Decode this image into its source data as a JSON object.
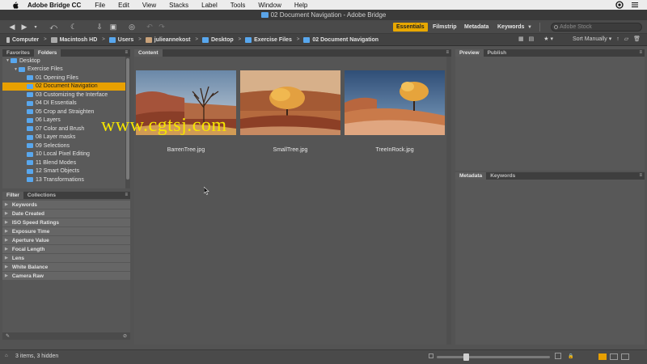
{
  "menubar": {
    "app_name": "Adobe Bridge CC",
    "items": [
      "File",
      "Edit",
      "View",
      "Stacks",
      "Label",
      "Tools",
      "Window",
      "Help"
    ]
  },
  "window": {
    "title": "02 Document Navigation - Adobe Bridge"
  },
  "workspaces": [
    {
      "label": "Essentials",
      "active": true
    },
    {
      "label": "Filmstrip",
      "active": false
    },
    {
      "label": "Metadata",
      "active": false
    },
    {
      "label": "Keywords",
      "active": false
    }
  ],
  "search": {
    "placeholder": "Adobe Stock"
  },
  "path": [
    {
      "label": "Computer"
    },
    {
      "label": "Macintosh HD"
    },
    {
      "label": "Users"
    },
    {
      "label": "julieannekost"
    },
    {
      "label": "Desktop"
    },
    {
      "label": "Exercise Files"
    },
    {
      "label": "02 Document Navigation"
    }
  ],
  "sort": {
    "label": "Sort Manually"
  },
  "left_top_tabs": [
    {
      "label": "Favorites",
      "active": false
    },
    {
      "label": "Folders",
      "active": true
    }
  ],
  "folders": [
    {
      "label": "Desktop",
      "level": 0,
      "selected": false
    },
    {
      "label": "Exercise Files",
      "level": 1,
      "selected": false
    },
    {
      "label": "01 Opening Files",
      "level": 2,
      "selected": false
    },
    {
      "label": "02 Document Navigation",
      "level": 2,
      "selected": true
    },
    {
      "label": "03 Customizing the Interface",
      "level": 2,
      "selected": false
    },
    {
      "label": "04 DI Essentials",
      "level": 2,
      "selected": false
    },
    {
      "label": "05 Crop and Straighten",
      "level": 2,
      "selected": false
    },
    {
      "label": "06 Layers",
      "level": 2,
      "selected": false
    },
    {
      "label": "07 Color and Brush",
      "level": 2,
      "selected": false
    },
    {
      "label": "08 Layer masks",
      "level": 2,
      "selected": false
    },
    {
      "label": "09 Selections",
      "level": 2,
      "selected": false
    },
    {
      "label": "10 Local Pixel Editing",
      "level": 2,
      "selected": false
    },
    {
      "label": "11 Blend Modes",
      "level": 2,
      "selected": false
    },
    {
      "label": "12 Smart Objects",
      "level": 2,
      "selected": false
    },
    {
      "label": "13 Transformations",
      "level": 2,
      "selected": false
    }
  ],
  "left_bottom_tabs": [
    {
      "label": "Filter",
      "active": true
    },
    {
      "label": "Collections",
      "active": false
    }
  ],
  "filters": [
    "Keywords",
    "Date Created",
    "ISO Speed Ratings",
    "Exposure Time",
    "Aperture Value",
    "Focal Length",
    "Lens",
    "White Balance",
    "Camera Raw"
  ],
  "content": {
    "tab": "Content",
    "items": [
      {
        "name": "BarrenTree.jpg"
      },
      {
        "name": "SmallTree.jpg"
      },
      {
        "name": "TreeInRock.jpg"
      }
    ],
    "watermark": "www.cgtsj.com"
  },
  "right_top_tabs": [
    {
      "label": "Preview",
      "active": true
    },
    {
      "label": "Publish",
      "active": false
    }
  ],
  "right_bottom_tabs": [
    {
      "label": "Metadata",
      "active": true
    },
    {
      "label": "Keywords",
      "active": false
    }
  ],
  "status": {
    "text": "3 items, 3 hidden"
  },
  "zoom": {
    "level": 0.25
  },
  "colors": {
    "accent": "#e8a000",
    "folder": "#58a7ee"
  }
}
